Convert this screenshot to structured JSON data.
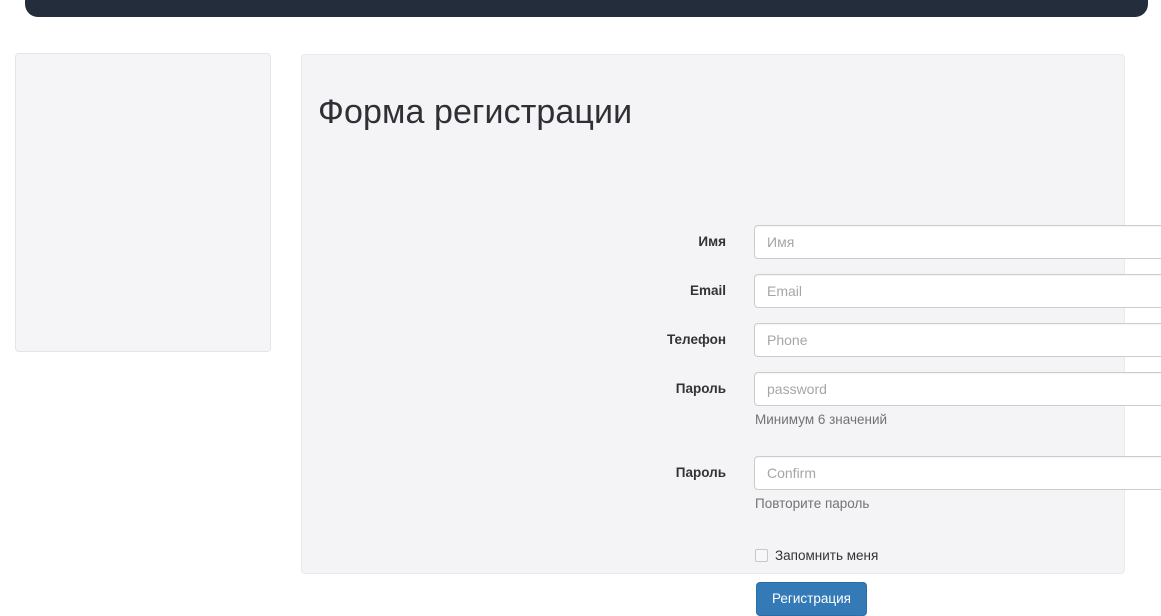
{
  "navbar": {
    "color": "#242d3c"
  },
  "side_panel": {
    "content": ""
  },
  "form": {
    "title": "Форма регистрации",
    "fields": [
      {
        "label": "Имя",
        "placeholder": "Имя",
        "value": "",
        "type": "text",
        "help": ""
      },
      {
        "label": "Email",
        "placeholder": "Email",
        "value": "",
        "type": "email",
        "help": ""
      },
      {
        "label": "Телефон",
        "placeholder": "Phone",
        "value": "",
        "type": "tel",
        "help": ""
      },
      {
        "label": "Пароль",
        "placeholder": "password",
        "value": "",
        "type": "password",
        "help": "Минимум 6 значений"
      },
      {
        "label": "Пароль",
        "placeholder": "Confirm",
        "value": "",
        "type": "password",
        "help": "Повторите пароль"
      }
    ],
    "remember_label": "Запомнить меня",
    "remember_checked": false,
    "submit_label": "Регистрация",
    "submit_color": "#337ab7"
  }
}
